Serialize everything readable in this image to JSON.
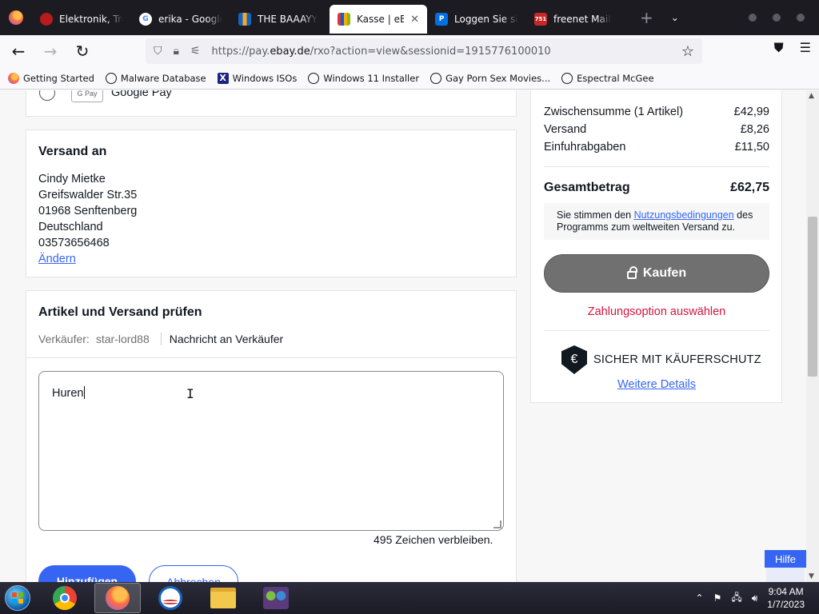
{
  "browser": {
    "tabs": [
      {
        "label": "Elektronik, Tre",
        "fav_color": "#b71c1c"
      },
      {
        "label": "erika - Google",
        "fav_color": "#ffffff"
      },
      {
        "label": "THE BAAAYY",
        "fav_color": "#f9a825"
      },
      {
        "label": "Kasse | eBay",
        "fav_color": "#e53238",
        "active": true
      },
      {
        "label": "Loggen Sie sich",
        "fav_color": "#0070e0"
      },
      {
        "label": "freenet Mail",
        "fav_color": "#c62828",
        "fav_text": "751"
      }
    ],
    "url_prefix": "https://pay.",
    "url_domain": "ebay.de",
    "url_suffix": "/rxo?action=view&sessionid=1915776100010",
    "bookmarks": [
      {
        "label": "Getting Started",
        "icon": "firefox-icon"
      },
      {
        "label": "Malware Database",
        "icon": "globe-icon"
      },
      {
        "label": "Windows ISOs",
        "icon": "x-icon"
      },
      {
        "label": "Windows 11 Installer",
        "icon": "globe-icon"
      },
      {
        "label": "Gay Porn Sex Movies...",
        "icon": "globe-icon"
      },
      {
        "label": "Espectral McGee",
        "icon": "globe-icon"
      }
    ]
  },
  "payment": {
    "gpay_logo": "G Pay",
    "google_pay_label": "Google Pay"
  },
  "shipping": {
    "title": "Versand an",
    "name": "Cindy Mietke",
    "street": "Greifswalder Str.35",
    "city": "01968 Senftenberg",
    "country": "Deutschland",
    "phone": "03573656468",
    "change_link": "Ändern"
  },
  "review": {
    "title": "Artikel und Versand prüfen",
    "seller_label": "Verkäufer:",
    "seller_name": "star-lord88",
    "message_link": "Nachricht an Verkäufer",
    "message_text": "Huren",
    "remaining": "495 Zeichen verbleiben.",
    "add_button": "Hinzufügen",
    "cancel_button": "Abbrechen"
  },
  "summary": {
    "subtotal_label": "Zwischensumme (1 Artikel)",
    "subtotal_value": "£42,99",
    "shipping_label": "Versand",
    "shipping_value": "£8,26",
    "import_label": "Einfuhrabgaben",
    "import_value": "£11,50",
    "total_label": "Gesamtbetrag",
    "total_value": "£62,75",
    "terms_pre": "Sie stimmen den ",
    "terms_link": "Nutzungsbedingungen",
    "terms_post": " des Programms zum weltweiten Versand zu.",
    "buy_button": "Kaufen",
    "payment_option": "Zahlungsoption auswählen",
    "protection_label": "SICHER MIT KÄUFERSCHUTZ",
    "protection_symbol": "€",
    "more_details": "Weitere Details"
  },
  "help_button": "Hilfe",
  "taskbar": {
    "time": "9:04 AM",
    "date": "1/7/2023"
  }
}
